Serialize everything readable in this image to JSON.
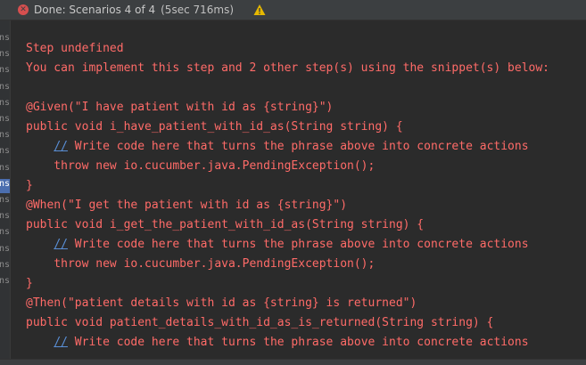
{
  "status": {
    "text": "Done: Scenarios 4 of 4",
    "duration": "(5sec 716ms)",
    "error_icon": "x-circle-icon",
    "warning_icon": "warning-triangle-icon"
  },
  "gutter": {
    "rows": [
      "ns",
      "ns",
      "ns",
      "ns",
      "ns",
      "ns",
      "ns",
      "ns",
      "ns",
      "ns",
      "ns",
      "ns",
      "ns",
      "ns",
      "ns",
      "ns"
    ]
  },
  "console": {
    "lines": [
      {
        "text": "Step undefined"
      },
      {
        "text": "You can implement this step and 2 other step(s) using the snippet(s) below:"
      },
      {
        "text": ""
      },
      {
        "text": "@Given(\"I have patient with id as {string}\")"
      },
      {
        "text": "public void i_have_patient_with_id_as(String string) {"
      },
      {
        "text": "    // Write code here that turns the phrase above into concrete actions"
      },
      {
        "text": "    throw new io.cucumber.java.PendingException();"
      },
      {
        "text": "}"
      },
      {
        "text": "@When(\"I get the patient with id as {string}\")"
      },
      {
        "text": "public void i_get_the_patient_with_id_as(String string) {"
      },
      {
        "text": "    // Write code here that turns the phrase above into concrete actions"
      },
      {
        "text": "    throw new io.cucumber.java.PendingException();"
      },
      {
        "text": "}"
      },
      {
        "text": "@Then(\"patient details with id as {string} is returned\")"
      },
      {
        "text": "public void patient_details_with_id_as_is_returned(String string) {"
      },
      {
        "text": "    // Write code here that turns the phrase above into concrete actions"
      }
    ]
  },
  "colors": {
    "error_text": "#ff6b68",
    "background": "#2b2b2b",
    "status_bar": "#3c3f41",
    "warning": "#e6b800"
  }
}
